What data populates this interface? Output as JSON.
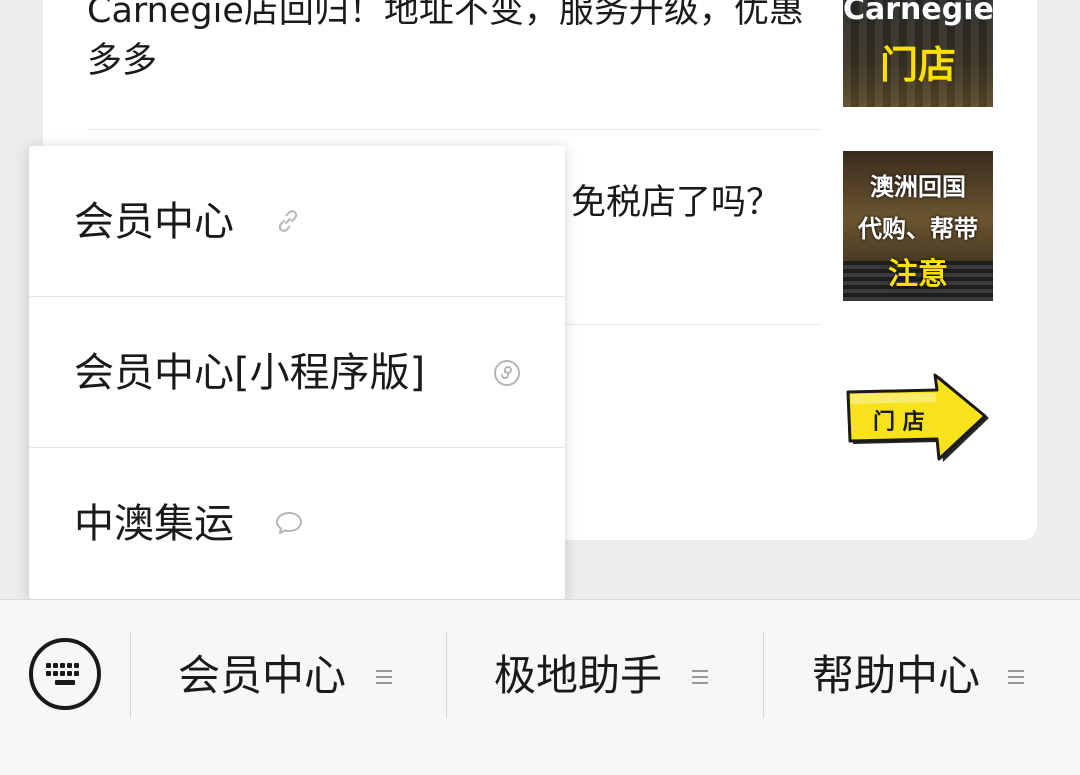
{
  "articles": [
    {
      "title": "Carnegie店回归！地址不变，服务升级，优惠多多",
      "thumb_text": [
        "Carnegie",
        "门店"
      ]
    },
    {
      "title_fragment": "免税店了吗？",
      "thumb_text": [
        "澳洲回国",
        "代购、帮带",
        "注意"
      ]
    },
    {
      "thumb_text": [
        "门 店"
      ]
    }
  ],
  "popup_menu": {
    "items": [
      {
        "label": "会员中心",
        "icon": "link-icon"
      },
      {
        "label": "会员中心[小程序版]",
        "icon": "mini-program-icon"
      },
      {
        "label": "中澳集运",
        "icon": "chat-bubble-icon"
      }
    ]
  },
  "bottom_bar": {
    "keyboard_icon": "keyboard-icon",
    "tabs": [
      {
        "label": "会员中心",
        "icon": "menu-lines-icon"
      },
      {
        "label": "极地助手",
        "icon": "menu-lines-icon"
      },
      {
        "label": "帮助中心",
        "icon": "menu-lines-icon"
      }
    ]
  },
  "colors": {
    "background": "#ededed",
    "thumb_yellow": "#f5d90a",
    "arrow_yellow": "#f7e21c"
  }
}
